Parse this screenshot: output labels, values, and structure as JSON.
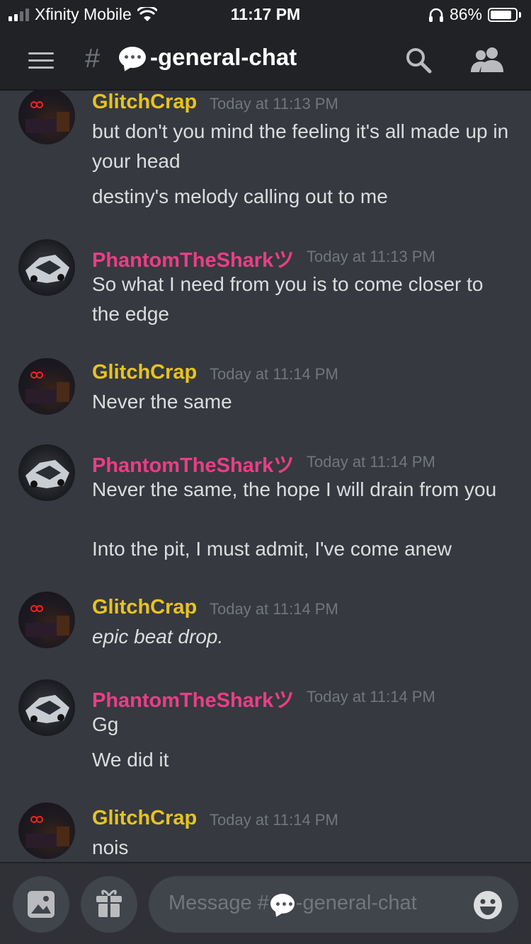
{
  "status_bar": {
    "carrier": "Xfinity Mobile",
    "time": "11:17 PM",
    "battery": "86%",
    "battery_level": 0.86
  },
  "header": {
    "hash": "#",
    "channel_name": "-general-chat"
  },
  "messages": [
    {
      "author": "GlitchCrap",
      "timestamp": "Today at 11:13 PM",
      "lines": [
        "but don't you mind the feeling it's all made up in your head",
        "destiny's melody calling out to me"
      ]
    },
    {
      "author": "PhantomTheSharkツ",
      "timestamp": "Today at 11:13 PM",
      "lines": [
        "So what I need from you is to come closer to the edge"
      ]
    },
    {
      "author": "GlitchCrap",
      "timestamp": "Today at 11:14 PM",
      "lines": [
        "Never the same"
      ]
    },
    {
      "author": "PhantomTheSharkツ",
      "timestamp": "Today at 11:14 PM",
      "lines": [
        "Never the same, the hope I will drain from you",
        "Into the pit, I must admit, I've come anew"
      ]
    },
    {
      "author": "GlitchCrap",
      "timestamp": "Today at 11:14 PM",
      "lines": [
        "epic beat drop."
      ]
    },
    {
      "author": "PhantomTheSharkツ",
      "timestamp": "Today at 11:14 PM",
      "lines": [
        "Gg",
        "We did it"
      ]
    },
    {
      "author": "GlitchCrap",
      "timestamp": "Today at 11:14 PM",
      "lines": [
        "nois"
      ]
    }
  ],
  "composer": {
    "placeholder_prefix": "Message #",
    "placeholder_channel": "-general-chat"
  },
  "colors": {
    "glitch_name": "#e8c321",
    "phantom_name": "#ea3e87",
    "background": "#36393f"
  },
  "icons": [
    "menu-icon",
    "speech-bubble-icon",
    "search-icon",
    "members-icon",
    "image-icon",
    "gift-icon",
    "emoji-icon",
    "wifi-icon",
    "headphones-icon",
    "battery-icon",
    "signal-icon"
  ]
}
